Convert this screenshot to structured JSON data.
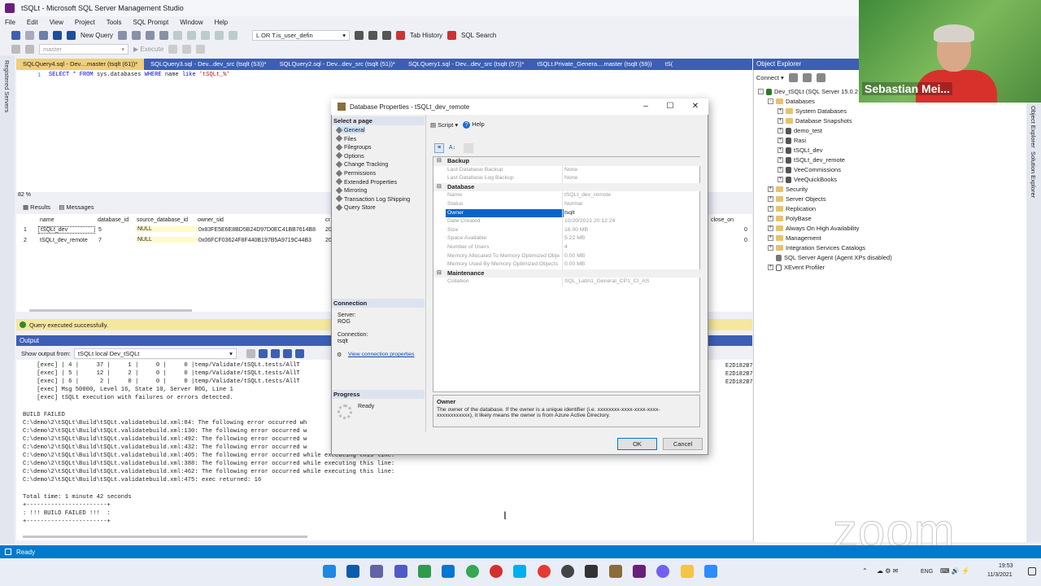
{
  "window": {
    "title": "tSQLt - Microsoft SQL Server Management Studio"
  },
  "menu": [
    "File",
    "Edit",
    "View",
    "Project",
    "Tools",
    "SQL Prompt",
    "Window",
    "Help"
  ],
  "toolbar": {
    "new_query": "New Query",
    "filter_value": "L OR T.is_user_defin",
    "tab_history": "Tab History",
    "sql_search": "SQL Search",
    "database": "master",
    "execute": "Execute"
  },
  "left_strip": "Registered Servers",
  "tabs": [
    {
      "label": "SQLQuery4.sql - Dev....master (tsqlt (61))*",
      "active": true
    },
    {
      "label": "SQLQuery3.sql - Dev...dev_src (tsqlt (53))*",
      "active": false
    },
    {
      "label": "SQLQuery2.sql - Dev...dev_src (tsqlt (51))*",
      "active": false
    },
    {
      "label": "SQLQuery1.sql - Dev...dev_src (tsqlt (57))*",
      "active": false
    },
    {
      "label": "tSQLt.Private_Genera....master (tsqlt (59))",
      "active": false
    },
    {
      "label": "tS(",
      "active": false
    }
  ],
  "editor": {
    "line_no": "1",
    "code_kw": "SELECT * FROM ",
    "code_obj": "sys.databases ",
    "code_kw2": "WHERE ",
    "code_col": "name ",
    "code_kw3": "like ",
    "code_str": "'tSQLt_%'"
  },
  "zoom": "82 %",
  "results": {
    "tabs": [
      "Results",
      "Messages"
    ],
    "columns": [
      "name",
      "database_id",
      "source_database_id",
      "owner_sid",
      "cr"
    ],
    "extra_col": "close_on",
    "rows": [
      {
        "n": "1",
        "name": "tSQLt_dev",
        "id": "5",
        "src": "NULL",
        "sid": "0x83FE5E6E8BD5B24D97D0EC41BB7614B8",
        "cr": "20",
        "close": "0"
      },
      {
        "n": "2",
        "name": "tSQLt_dev_remote",
        "id": "7",
        "src": "NULL",
        "sid": "0x06FCF03624F8F440B197B5A9719C44B3",
        "cr": "20",
        "close": "0"
      }
    ]
  },
  "query_status": "Query executed successfully.",
  "output": {
    "header": "Output",
    "show_from_label": "Show output from:",
    "show_from_value": "tSQLt local Dev_tSQLt",
    "text": "    [exec] | 4 |     37 |     1 |     0 |     0 |temp/Validate/tSQLt.tests/AllT\n    [exec] | 5 |     12 |     2 |     0 |     0 |temp/Validate/tSQLt.tests/AllT\n    [exec] | 6 |      2 |     0 |     0 |     0 |temp/Validate/tSQLt.tests/AllT\n    [exec] Msg 50000, Level 16, State 10, Server ROG, Line 1\n    [exec] tSQLt execution with failures or errors detected.\n\nBUILD FAILED\nC:\\demo\\2\\tSQLt\\Build\\tSQLt.validatebuild.xml:84: The following error occurred wh\nC:\\demo\\2\\tSQLt\\Build\\tSQLt.validatebuild.xml:130: The following error occurred w\nC:\\demo\\2\\tSQLt\\Build\\tSQLt.validatebuild.xml:492: The following error occurred w\nC:\\demo\\2\\tSQLt\\Build\\tSQLt.validatebuild.xml:432: The following error occurred w\nC:\\demo\\2\\tSQLt\\Build\\tSQLt.validatebuild.xml:405: The following error occurred while executing this line:\nC:\\demo\\2\\tSQLt\\Build\\tSQLt.validatebuild.xml:388: The following error occurred while executing this line:\nC:\\demo\\2\\tSQLt\\Build\\tSQLt.validatebuild.xml:462: The following error occurred while executing this line:\nC:\\demo\\2\\tSQLt\\Build\\tSQLt.validatebuild.xml:475: exec returned: 16\n\nTotal time: 1 minute 42 seconds\n+-----------------------+\n: !!! BUILD FAILED !!!  :\n+-----------------------+",
    "right_fragment": "E2D182B7F2E"
  },
  "object_explorer": {
    "title": "Object Explorer",
    "connect": "Connect",
    "nodes": [
      {
        "label": "Dev_tSQLt (SQL Server 15.0.2",
        "level": 0,
        "exp": "-",
        "icon": "server"
      },
      {
        "label": "Databases",
        "level": 1,
        "exp": "-",
        "icon": "folder"
      },
      {
        "label": "System Databases",
        "level": 2,
        "exp": "+",
        "icon": "folder"
      },
      {
        "label": "Database Snapshots",
        "level": 2,
        "exp": "+",
        "icon": "folder"
      },
      {
        "label": "demo_test",
        "level": 2,
        "exp": "+",
        "icon": "db"
      },
      {
        "label": "Rasi",
        "level": 2,
        "exp": "+",
        "icon": "db"
      },
      {
        "label": "tSQLt_dev",
        "level": 2,
        "exp": "+",
        "icon": "db"
      },
      {
        "label": "tSQLt_dev_remote",
        "level": 2,
        "exp": "+",
        "icon": "db"
      },
      {
        "label": "VeeCommissions",
        "level": 2,
        "exp": "+",
        "icon": "db"
      },
      {
        "label": "VeeQuickBooks",
        "level": 2,
        "exp": "+",
        "icon": "db"
      },
      {
        "label": "Security",
        "level": 1,
        "exp": "+",
        "icon": "folder"
      },
      {
        "label": "Server Objects",
        "level": 1,
        "exp": "+",
        "icon": "folder"
      },
      {
        "label": "Replication",
        "level": 1,
        "exp": "+",
        "icon": "folder"
      },
      {
        "label": "PolyBase",
        "level": 1,
        "exp": "+",
        "icon": "folder"
      },
      {
        "label": "Always On High Availability",
        "level": 1,
        "exp": "+",
        "icon": "folder"
      },
      {
        "label": "Management",
        "level": 1,
        "exp": "+",
        "icon": "folder"
      },
      {
        "label": "Integration Services Catalogs",
        "level": 1,
        "exp": "+",
        "icon": "folder"
      },
      {
        "label": "SQL Server Agent (Agent XPs disabled)",
        "level": 1,
        "exp": "",
        "icon": "agent"
      },
      {
        "label": "XEvent Profiler",
        "level": 1,
        "exp": "+",
        "icon": "xevent"
      }
    ]
  },
  "right_strip": [
    "Object Explorer",
    "Solution Explorer"
  ],
  "webcam": {
    "name": "Sebastian Mei..."
  },
  "dialog": {
    "title": "Database Properties - tSQLt_dev_remote",
    "select_page": "Select a page",
    "pages": [
      "General",
      "Files",
      "Filegroups",
      "Options",
      "Change Tracking",
      "Permissions",
      "Extended Properties",
      "Mirroring",
      "Transaction Log Shipping",
      "Query Store"
    ],
    "selected_page": "General",
    "script": "Script",
    "help": "Help",
    "connection": {
      "header": "Connection",
      "server_label": "Server:",
      "server": "ROG",
      "conn_label": "Connection:",
      "conn": "tsqlt",
      "view_link": "View connection properties"
    },
    "progress": {
      "header": "Progress",
      "status": "Ready"
    },
    "props": [
      {
        "cat": "Backup"
      },
      {
        "k": "Last Database Backup",
        "v": "None"
      },
      {
        "k": "Last Database Log Backup",
        "v": "None"
      },
      {
        "cat": "Database"
      },
      {
        "k": "Name",
        "v": "tSQLt_dev_remote"
      },
      {
        "k": "Status",
        "v": "Normal"
      },
      {
        "k": "Owner",
        "v": "tsqlt",
        "sel": true
      },
      {
        "k": "Date Created",
        "v": "10/20/2021 20:12:24"
      },
      {
        "k": "Size",
        "v": "16.00 MB"
      },
      {
        "k": "Space Available",
        "v": "5.22 MB"
      },
      {
        "k": "Number of Users",
        "v": "4"
      },
      {
        "k": "Memory Allocated To Memory Optimized Obje",
        "v": "0.00 MB"
      },
      {
        "k": "Memory Used By Memory Optimized Objects",
        "v": "0.00 MB"
      },
      {
        "cat": "Maintenance"
      },
      {
        "k": "Collation",
        "v": "SQL_Latin1_General_CP1_CI_AS"
      }
    ],
    "desc_title": "Owner",
    "desc_text": "The owner of the database. If the owner is a unique identifier (i.e. xxxxxxxx-xxxx-xxxx-xxxx-xxxxxxxxxxxx), it likely means the owner is from Azure Active Directory.",
    "ok": "OK",
    "cancel": "Cancel"
  },
  "statusbar": {
    "text": "Ready"
  },
  "taskbar": {
    "lang": "ENG",
    "time": "19:53",
    "date": "11/3/2021"
  },
  "watermark": "zoom",
  "colors": {
    "accent": "#3c5fb5",
    "status": "#007acc",
    "selected": "#0a64c8",
    "query_ok": "#f5e79e"
  }
}
